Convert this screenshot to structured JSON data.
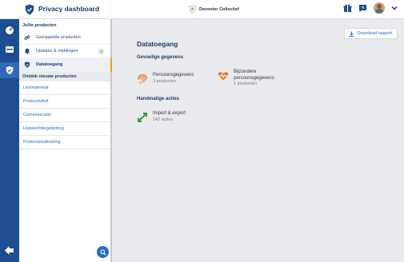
{
  "header": {
    "app_title": "Privacy dashboard",
    "organization": "Deventer Collectief"
  },
  "sidebar": {
    "section_products": "Jullie producten",
    "items": [
      {
        "label": "Gekoppelde producten",
        "icon": "link-icon"
      },
      {
        "label": "Updates & meldingen",
        "icon": "bell-icon",
        "count": "0"
      },
      {
        "label": "Datatoegang",
        "icon": "shield-icon",
        "active": true
      }
    ],
    "section_discover": "Ontdek nieuwe producten",
    "links": [
      "Lesmateriaal",
      "Productiviteit",
      "Communicatie",
      "Huiswerkbegeleiding",
      "Professionalisering"
    ]
  },
  "main": {
    "download_label": "Download rapport",
    "title": "Datatoegang",
    "section_sensitive": "Gevoelige gegevens",
    "cards": [
      {
        "title": "Persoonsgegevens",
        "sub": "3 producten",
        "icon": "fingerprint-icon",
        "color": "#e07a2e"
      },
      {
        "title_line1": "Bijzondere",
        "title_line2": "persoonsgegevens",
        "sub": "1 producten",
        "icon": "heartbeat-icon",
        "color": "#e07a2e"
      }
    ],
    "section_actions": "Handmatige acties",
    "action": {
      "title": "Import & export",
      "sub": "142 acties",
      "icon": "import-export-icon",
      "color": "#2e9e3e"
    }
  },
  "colors": {
    "rail": "#1d4e8f",
    "accent": "#1f6fc5",
    "active_marker": "#f0a500"
  }
}
